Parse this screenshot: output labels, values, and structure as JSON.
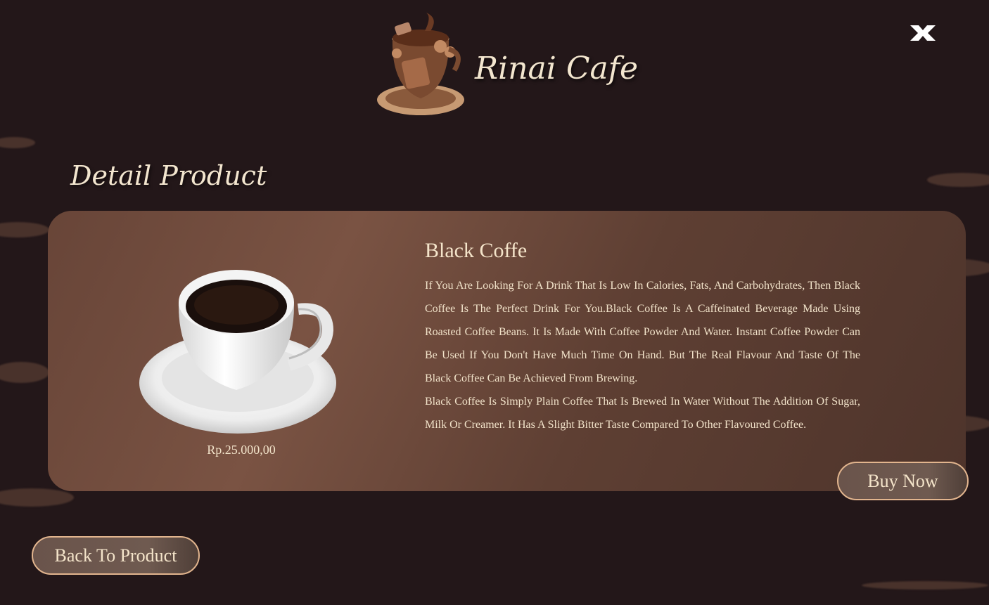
{
  "header": {
    "brand_name": "Rinai Cafe",
    "logo_icon": "coffee-cup-logo-icon",
    "close_icon": "close-icon"
  },
  "page_title": "Detail Product",
  "product": {
    "name": "Black Coffe",
    "price": "Rp.25.000,00",
    "image_icon": "coffee-cup-image",
    "description": [
      "If You Are Looking For A Drink That Is Low In Calories, Fats, And Carbohydrates, Then Black Coffee Is The Perfect Drink For You.Black Coffee Is A Caffeinated Beverage Made Using Roasted Coffee Beans. It Is Made With Coffee Powder And Water. Instant Coffee Powder Can Be Used If You Don't Have Much Time On Hand. But The Real Flavour And Taste Of The Black Coffee Can Be Achieved From Brewing.",
      "Black Coffee Is Simply Plain Coffee That Is Brewed In Water Without The Addition Of Sugar, Milk Or Creamer. It Has A Slight Bitter Taste Compared To Other Flavoured Coffee."
    ]
  },
  "buttons": {
    "buy_now": "Buy Now",
    "back_to_product": "Back To Product"
  },
  "colors": {
    "background": "#231719",
    "card": "#6b4739",
    "text": "#f1e2c9",
    "button_border": "#e2b58e"
  }
}
